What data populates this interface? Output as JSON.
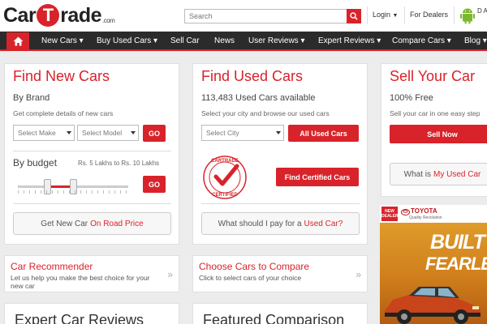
{
  "header": {
    "logo_left": "Car",
    "logo_t": "T",
    "logo_right": "rade",
    "logo_suffix": ".com",
    "search_placeholder": "Search",
    "login_label": "Login",
    "dealers_label": "For Dealers",
    "android_text": "D A"
  },
  "nav": {
    "items": [
      {
        "label": "New Cars",
        "caret": true
      },
      {
        "label": "Buy Used Cars",
        "caret": true
      },
      {
        "label": "Sell Car",
        "caret": false
      },
      {
        "label": "News",
        "caret": false
      },
      {
        "label": "User Reviews",
        "caret": true
      },
      {
        "label": "Expert Reviews",
        "caret": true
      },
      {
        "label": "Compare Cars",
        "caret": true
      },
      {
        "label": "Blog",
        "caret": true
      }
    ]
  },
  "new_cars": {
    "title": "Find New Cars",
    "by_brand": "By Brand",
    "brand_desc": "Get complete details of new cars",
    "make_placeholder": "Select Make",
    "model_placeholder": "Select Model",
    "go_label": "GO",
    "by_budget": "By budget",
    "budget_range": "Rs. 5 Lakhs to Rs. 10 Lakhs",
    "go2_label": "GO",
    "on_road_prefix": "Get New Car",
    "on_road_highlight": "On Road Price"
  },
  "used_cars": {
    "title": "Find Used Cars",
    "count_text": "113,483 Used Cars available",
    "desc": "Select your city and browse our used cars",
    "city_placeholder": "Select City",
    "all_used_label": "All Used Cars",
    "certified_label": "Find Certified Cars",
    "stamp_top": "CARTRADE",
    "stamp_bottom": "CERTIFIED",
    "pay_prefix": "What should I pay for a",
    "pay_highlight": "Used Car?"
  },
  "sell_car": {
    "title": "Sell Your Car",
    "free_text": "100% Free",
    "desc": "Sell your car in one easy step",
    "sell_now_label": "Sell Now",
    "what_prefix": "What is",
    "what_highlight": "My Used Car"
  },
  "recommender": {
    "title": "Car Recommender",
    "desc": "Let us help you make the best choice for your new car",
    "chevron": "»"
  },
  "compare": {
    "title": "Choose Cars to Compare",
    "desc": "Click to select cars of your choice",
    "chevron": "»"
  },
  "bottom": {
    "expert_title": "Expert Car Reviews",
    "featured_title": "Featured Comparison"
  },
  "ad": {
    "badge": "NEW DEALER",
    "brand": "TOYOTA",
    "tagline": "Quality Revolution",
    "line1": "BUILT",
    "line2": "FEARLES"
  },
  "colors": {
    "accent": "#d8232a",
    "nav_bg": "#2b2b2b"
  }
}
